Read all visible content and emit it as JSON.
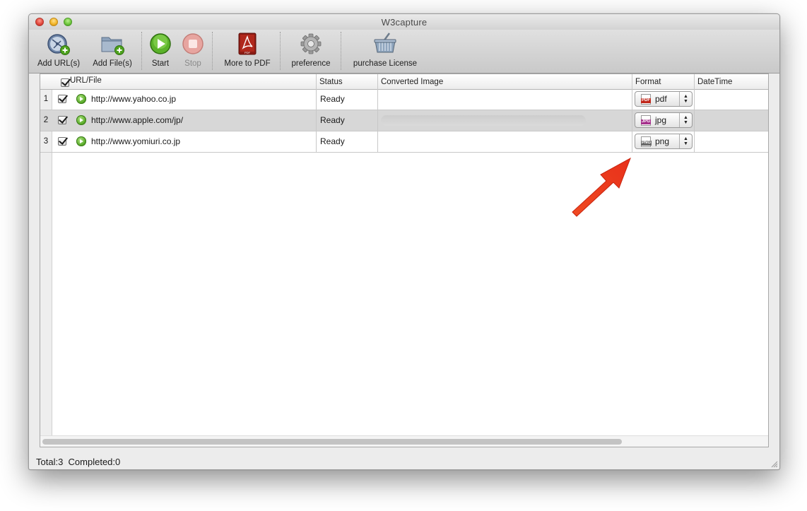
{
  "window": {
    "title": "W3capture"
  },
  "toolbar": {
    "add_urls": "Add URL(s)",
    "add_files": "Add File(s)",
    "start": "Start",
    "stop": "Stop",
    "more_pdf": "More to PDF",
    "preference": "preference",
    "purchase": "purchase License"
  },
  "table": {
    "columns": {
      "url": "URL/File",
      "status": "Status",
      "converted": "Converted Image",
      "format": "Format",
      "datetime": "DateTime"
    },
    "rows": [
      {
        "num": "1",
        "url": "http://www.yahoo.co.jp",
        "status": "Ready",
        "format": "pdf",
        "format_badge": "PDF",
        "badge_color": "#c0281c"
      },
      {
        "num": "2",
        "url": "http://www.apple.com/jp/",
        "status": "Ready",
        "format": "jpg",
        "format_badge": "JPG",
        "badge_color": "#a5318c"
      },
      {
        "num": "3",
        "url": "http://www.yomiuri.co.jp",
        "status": "Ready",
        "format": "png",
        "format_badge": "PNG",
        "badge_color": "#6a6a6a"
      }
    ]
  },
  "status": {
    "total": "Total:3",
    "completed": "Completed:0"
  },
  "colors": {
    "annotation_arrow": "#f23a1a",
    "play_green": "#4ea21e",
    "selected_row": "#d7d7d7"
  }
}
